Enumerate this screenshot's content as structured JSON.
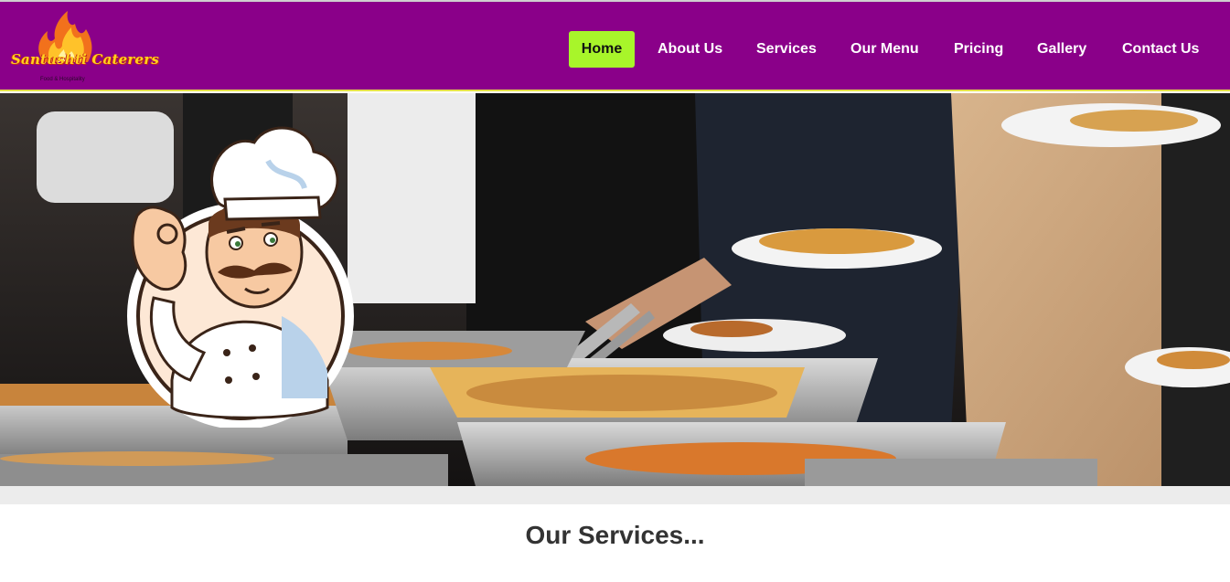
{
  "brand": {
    "name": "Santushti Caterers",
    "tagline": "Food & Hospitality"
  },
  "nav": {
    "items": [
      {
        "label": "Home",
        "active": true
      },
      {
        "label": "About Us",
        "active": false
      },
      {
        "label": "Services",
        "active": false
      },
      {
        "label": "Our Menu",
        "active": false
      },
      {
        "label": "Pricing",
        "active": false
      },
      {
        "label": "Gallery",
        "active": false
      },
      {
        "label": "Contact Us",
        "active": false
      }
    ]
  },
  "colors": {
    "navbar": "#8a0089",
    "active_nav": "#a8f52a",
    "band": "#ececec",
    "heading": "#333333"
  },
  "hero": {
    "image": "catering-buffet-photo",
    "mascot": "chef-mascot-illustration"
  },
  "section": {
    "title": "Our Services..."
  }
}
